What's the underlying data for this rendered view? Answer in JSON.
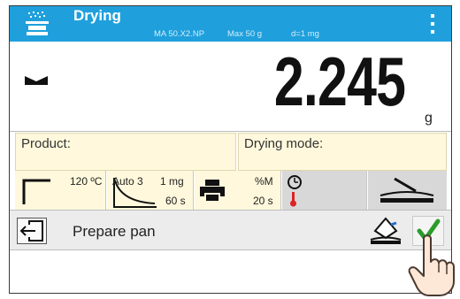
{
  "header": {
    "title": "Drying",
    "model": "MA 50.X2.NP",
    "max": "Max 50 g",
    "division": "d=1 mg",
    "icons": {
      "app": "drying-pan-icon",
      "menu": "vertical-dots-menu-icon"
    }
  },
  "reading": {
    "value": "2.245",
    "unit": "g",
    "stability_icon": "stable-indicator-icon"
  },
  "info": {
    "product_label": "Product:",
    "drying_mode_label": "Drying mode:"
  },
  "tiles": {
    "temperature": "120 ºC",
    "profile": "Auto 3",
    "resolution": "1 mg",
    "profile_time": "60 s",
    "print_unit": "%M",
    "print_interval": "20 s",
    "icons": {
      "standard_profile": "standard-drying-profile-icon",
      "auto_profile": "auto-switchoff-curve-icon",
      "print": "printer-icon",
      "status": "timer-thermometer-icon",
      "pan": "pan-handler-icon"
    }
  },
  "bottom": {
    "prompt": "Prepare pan",
    "icons": {
      "exit": "exit-icon",
      "tare": "tare-pan-icon",
      "ok": "checkmark-icon",
      "pointer": "pointing-hand-icon"
    }
  },
  "colors": {
    "header": "#1fa0dc",
    "field": "#fff8dc",
    "ok": "#2a9c2a",
    "gray_tile": "#d8d8d8"
  }
}
